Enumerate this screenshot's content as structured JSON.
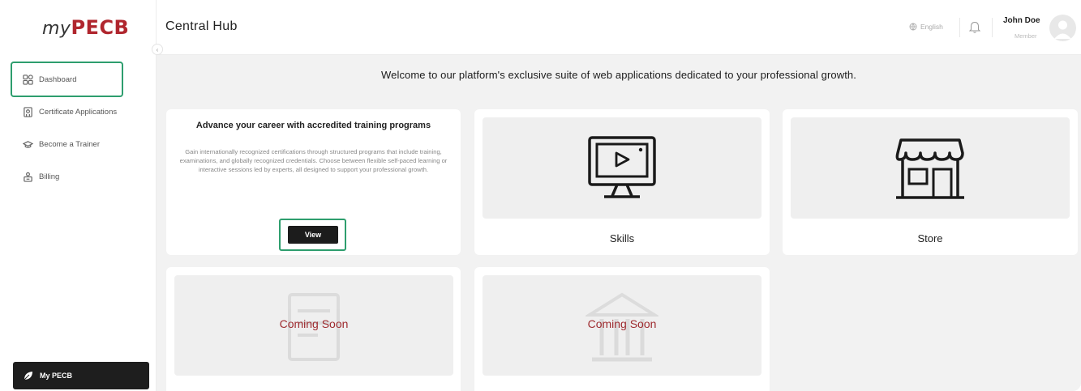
{
  "sidebar": {
    "logo_my": "my",
    "logo_pecb": "PECB",
    "items": [
      {
        "label": "Dashboard",
        "icon": "grid-icon",
        "active": true
      },
      {
        "label": "Certificate Applications",
        "icon": "certificate-icon",
        "active": false
      },
      {
        "label": "Become a Trainer",
        "icon": "trainer-icon",
        "active": false
      },
      {
        "label": "Billing",
        "icon": "billing-icon",
        "active": false
      }
    ],
    "footer_label": "My PECB"
  },
  "header": {
    "title": "Central Hub",
    "language": "English",
    "user_name": "John Doe",
    "user_role": "Member"
  },
  "main": {
    "welcome": "Welcome to our platform's exclusive suite of web applications dedicated to your professional growth.",
    "training_card": {
      "title": "Advance your career with accredited training programs",
      "description": "Gain internationally recognized certifications through structured programs that include training, examinations, and globally recognized credentials. Choose between flexible self-paced learning or interactive sessions led by experts, all designed to support your professional growth.",
      "button_label": "View"
    },
    "skills_card": {
      "label": "Skills",
      "icon": "monitor-play-icon"
    },
    "store_card": {
      "label": "Store",
      "icon": "storefront-icon"
    },
    "coming_soon_cards": [
      {
        "label": "Coming Soon",
        "icon": "document-icon"
      },
      {
        "label": "Coming Soon",
        "icon": "institution-icon"
      }
    ]
  },
  "colors": {
    "brand_red": "#b0262e",
    "highlight_green": "#2e9e6e",
    "coming_soon_red": "#9e2b2f",
    "dark_button": "#1c1c1c"
  }
}
